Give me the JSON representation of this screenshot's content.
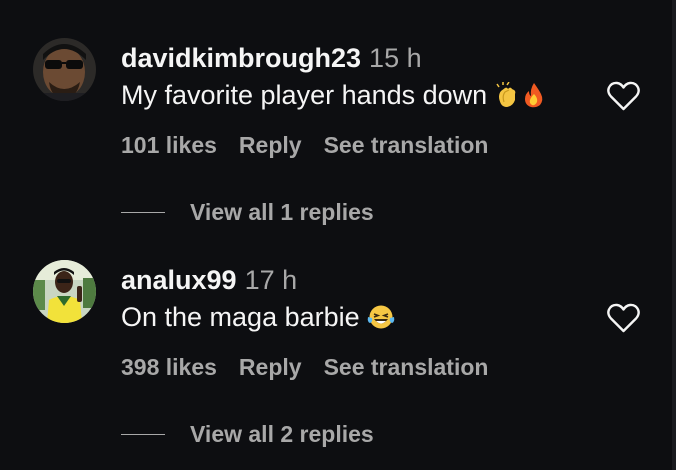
{
  "comments": [
    {
      "username": "davidkimbrough23",
      "time": "15 h",
      "text": "My favorite player hands down",
      "emojis": [
        "clapping-hands",
        "fire"
      ],
      "likes": "101 likes",
      "reply_label": "Reply",
      "translate_label": "See translation",
      "view_replies": "View all 1 replies"
    },
    {
      "username": "analux99",
      "time": "17 h",
      "text": "On the maga barbie",
      "emojis": [
        "laughing-tears"
      ],
      "likes": "398 likes",
      "reply_label": "Reply",
      "translate_label": "See translation",
      "view_replies": "View all 2 replies"
    }
  ],
  "icons": {
    "like": "heart-outline-icon"
  },
  "colors": {
    "background": "#0d0e11",
    "primary_text": "#f5f5f5",
    "secondary_text": "#a8a8a8"
  }
}
